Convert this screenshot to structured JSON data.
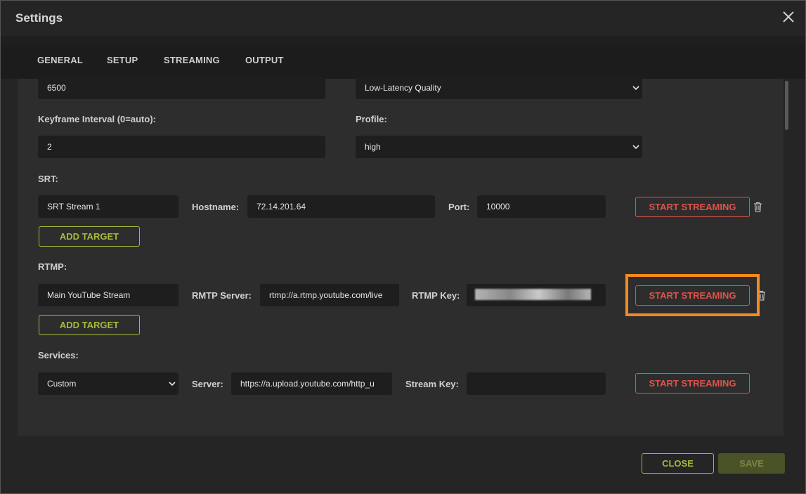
{
  "dialog": {
    "title": "Settings"
  },
  "tabs": [
    {
      "label": "GENERAL"
    },
    {
      "label": "SETUP"
    },
    {
      "label": "STREAMING"
    },
    {
      "label": "OUTPUT"
    }
  ],
  "encoder": {
    "bitrate_value": "6500",
    "tune_value": "Low-Latency Quality",
    "keyframe_label": "Keyframe Interval (0=auto):",
    "keyframe_value": "2",
    "profile_label": "Profile:",
    "profile_value": "high"
  },
  "srt": {
    "section_label": "SRT:",
    "name_value": "SRT Stream 1",
    "hostname_label": "Hostname:",
    "hostname_value": "72.14.201.64",
    "port_label": "Port:",
    "port_value": "10000",
    "start_label": "START STREAMING",
    "add_target_label": "ADD TARGET"
  },
  "rtmp": {
    "section_label": "RTMP:",
    "name_value": "Main YouTube Stream",
    "server_label": "RMTP Server:",
    "server_value": "rtmp://a.rtmp.youtube.com/live",
    "key_label": "RTMP Key:",
    "start_label": "START STREAMING",
    "add_target_label": "ADD TARGET"
  },
  "services": {
    "section_label": "Services:",
    "service_value": "Custom",
    "server_label": "Server:",
    "server_value": "https://a.upload.youtube.com/http_u",
    "stream_key_label": "Stream Key:",
    "stream_key_value": "",
    "start_label": "START STREAMING"
  },
  "footer": {
    "close_label": "CLOSE",
    "save_label": "SAVE"
  },
  "colors": {
    "accent": "#a8b93a",
    "danger": "#e0524a",
    "highlight": "#f78a1e"
  }
}
